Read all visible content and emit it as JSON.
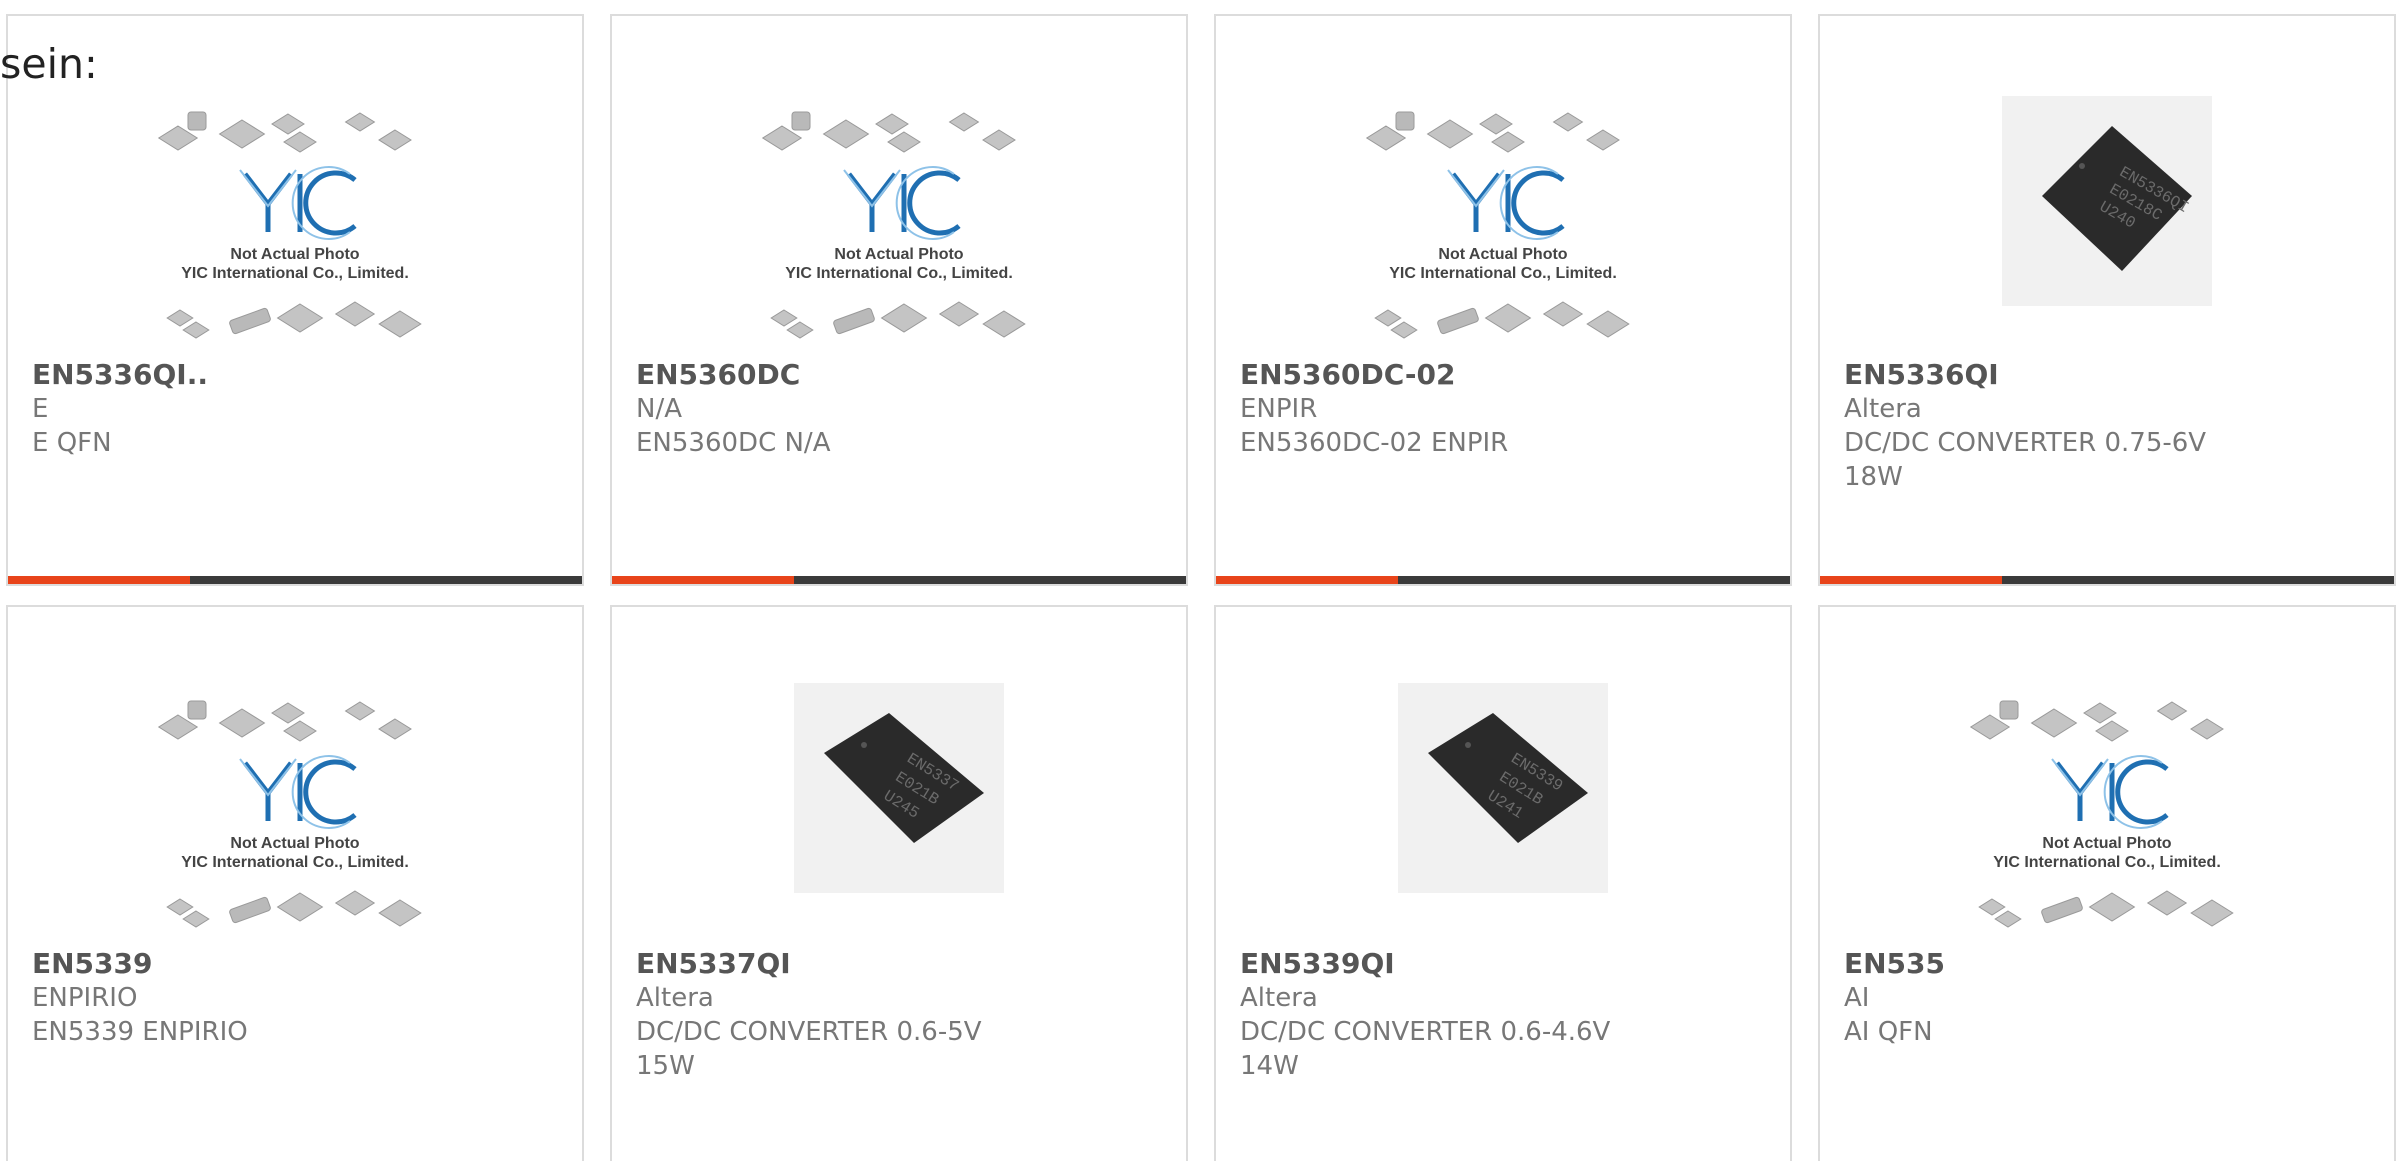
{
  "intro_text": "sein:",
  "placeholder": {
    "line1": "Not Actual Photo",
    "line2": "YIC International Co., Limited.",
    "logo": "YIC"
  },
  "cards": [
    {
      "pn": "EN5336QI..",
      "mfr": "E",
      "desc": "E QFN",
      "image": "placeholder"
    },
    {
      "pn": "EN5360DC",
      "mfr": "N/A",
      "desc": "EN5360DC N/A",
      "image": "placeholder"
    },
    {
      "pn": "EN5360DC-02",
      "mfr": "ENPIR",
      "desc": "EN5360DC-02 ENPIR",
      "image": "placeholder"
    },
    {
      "pn": "EN5336QI",
      "mfr": "Altera",
      "desc": "DC/DC CONVERTER 0.75-6V 18W",
      "image": "chip-square",
      "chip_text": [
        "EN5336QI",
        "E0218C",
        "U240"
      ]
    },
    {
      "pn": "EN5339",
      "mfr": "ENPIRIO",
      "desc": "EN5339 ENPIRIO",
      "image": "placeholder"
    },
    {
      "pn": "EN5337QI",
      "mfr": "Altera",
      "desc": "DC/DC CONVERTER 0.6-5V 15W",
      "image": "chip-rect",
      "chip_text": [
        "EN5337",
        "E021B",
        "U245"
      ]
    },
    {
      "pn": "EN5339QI",
      "mfr": "Altera",
      "desc": "DC/DC CONVERTER 0.6-4.6V 14W",
      "image": "chip-rect",
      "chip_text": [
        "EN5339",
        "E021B",
        "U241"
      ]
    },
    {
      "pn": "EN535",
      "mfr": "AI",
      "desc": "AI QFN",
      "image": "placeholder"
    }
  ],
  "colors": {
    "accent": "#e8441a",
    "bar": "#3a3a3a",
    "border": "#dcdcdc"
  }
}
